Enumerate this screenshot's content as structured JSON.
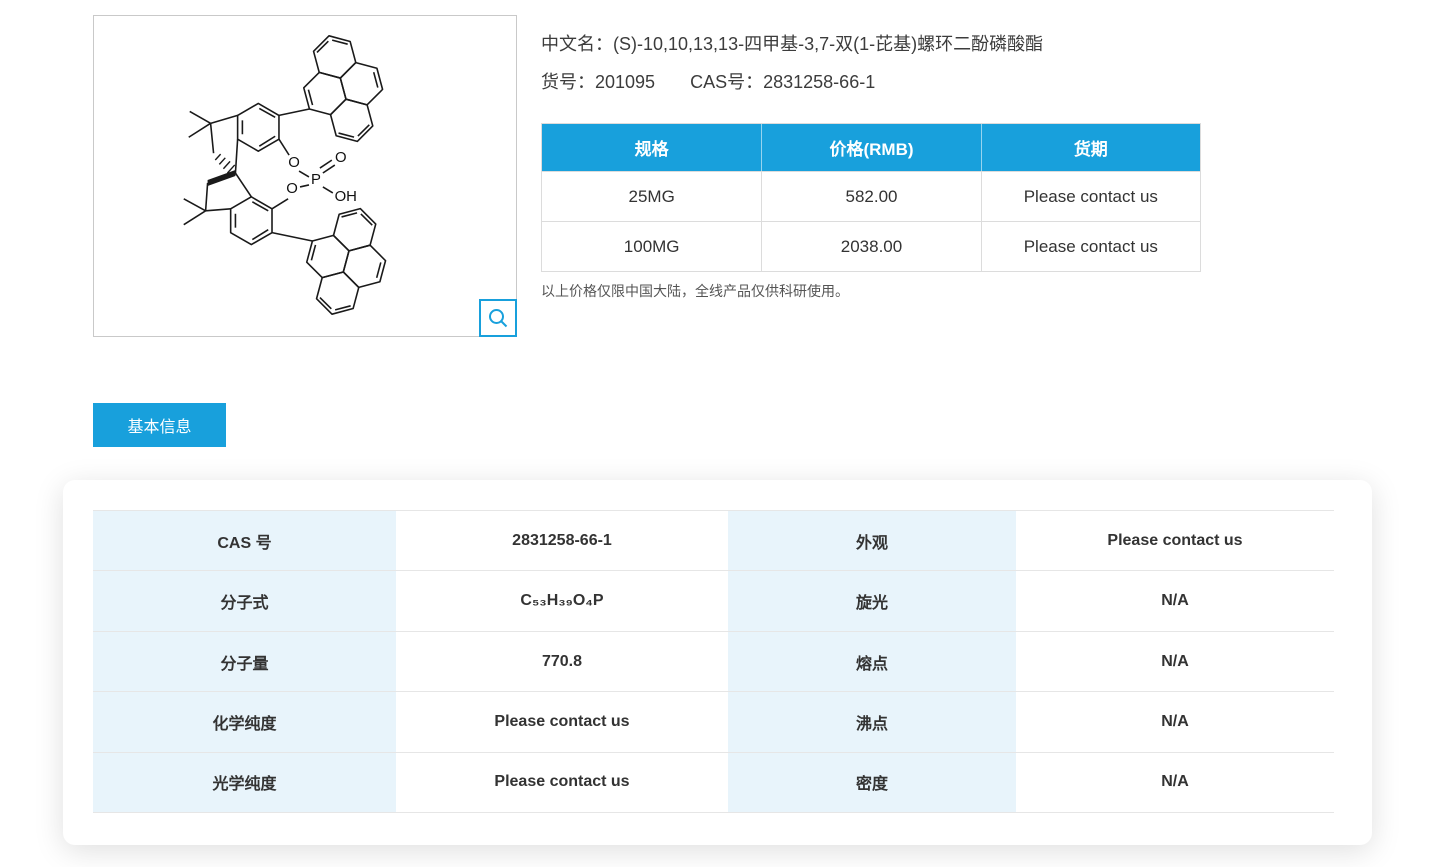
{
  "colors": {
    "accent": "#18a0dc",
    "label_cell_bg": "#e8f4fb",
    "table_border": "#dcdcdc"
  },
  "product": {
    "name_label": "中文名：",
    "name": "(S)-10,10,13,13-四甲基-3,7-双(1-芘基)螺环二酚磷酸酯",
    "catalog_label": "货号：",
    "catalog_no": "201095",
    "cas_label": "CAS号：",
    "cas_no": "2831258-66-1"
  },
  "structure_panel": {
    "zoom_icon": "magnifier"
  },
  "price_table": {
    "headers": [
      "规格",
      "价格(RMB)",
      "货期"
    ],
    "rows": [
      [
        "25MG",
        "582.00",
        "Please contact us"
      ],
      [
        "100MG",
        "2038.00",
        "Please contact us"
      ]
    ],
    "note": "以上价格仅限中国大陆，全线产品仅供科研使用。"
  },
  "tabs": {
    "basic_info": "基本信息"
  },
  "details_table": {
    "rows": [
      [
        "CAS 号",
        "2831258-66-1",
        "外观",
        "Please contact us"
      ],
      [
        "分子式",
        "C₅₃H₃₉O₄P",
        "旋光",
        "N/A"
      ],
      [
        "分子量",
        "770.8",
        "熔点",
        "N/A"
      ],
      [
        "化学纯度",
        "Please contact us",
        "沸点",
        "N/A"
      ],
      [
        "光学纯度",
        "Please contact us",
        "密度",
        "N/A"
      ]
    ]
  }
}
